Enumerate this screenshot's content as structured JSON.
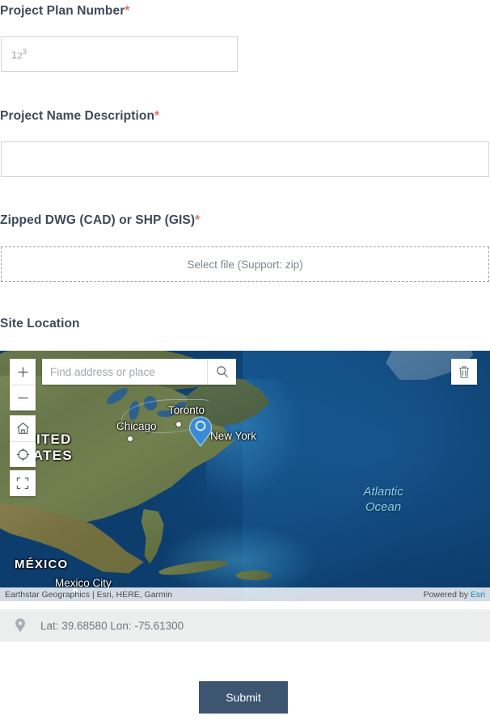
{
  "form": {
    "fields": [
      {
        "label": "Project Plan Number",
        "required_mark": "*",
        "placeholder": "123",
        "value": ""
      },
      {
        "label": "Project Name Description",
        "required_mark": "*",
        "placeholder": "",
        "value": ""
      },
      {
        "label": "Zipped DWG (CAD) or SHP (GIS)",
        "required_mark": "*",
        "dropzone_text": "Select file (Support: zip)"
      }
    ],
    "site_location": {
      "label": "Site Location"
    },
    "submit_label": "Submit"
  },
  "map": {
    "search": {
      "placeholder": "Find address or place",
      "value": "",
      "icon": "search-icon"
    },
    "controls": [
      {
        "name": "zoom-in",
        "glyph": "+"
      },
      {
        "name": "zoom-out",
        "glyph": "−"
      },
      {
        "name": "home",
        "glyph": "home-icon"
      },
      {
        "name": "locate",
        "glyph": "locate-icon"
      },
      {
        "name": "fullscreen",
        "glyph": "fullscreen-icon"
      }
    ],
    "delete_icon": "trash-icon",
    "labels": {
      "united_states": "UNITED\nSTATES",
      "mexico": "MÉXICO",
      "mexico_city": "Mexico City",
      "chicago": "Chicago",
      "toronto": "Toronto",
      "new_york": "New York",
      "atlantic_ocean": "Atlantic\nOcean"
    },
    "attribution": "Earthstar Geographics | Esri, HERE, Garmin",
    "powered_by_prefix": "Powered by ",
    "powered_by_link": "Esri",
    "coordinates": "Lat: 39.68580  Lon: -75.61300",
    "marker_icon": "map-pin-marker"
  },
  "colors": {
    "label_text": "#3d4a5c",
    "required_star": "#e8705a",
    "submit_bg": "#3d5571",
    "coord_bar_bg": "#eceded",
    "marker_blue": "#3a8ad6",
    "link_blue": "#1b7fc4"
  }
}
